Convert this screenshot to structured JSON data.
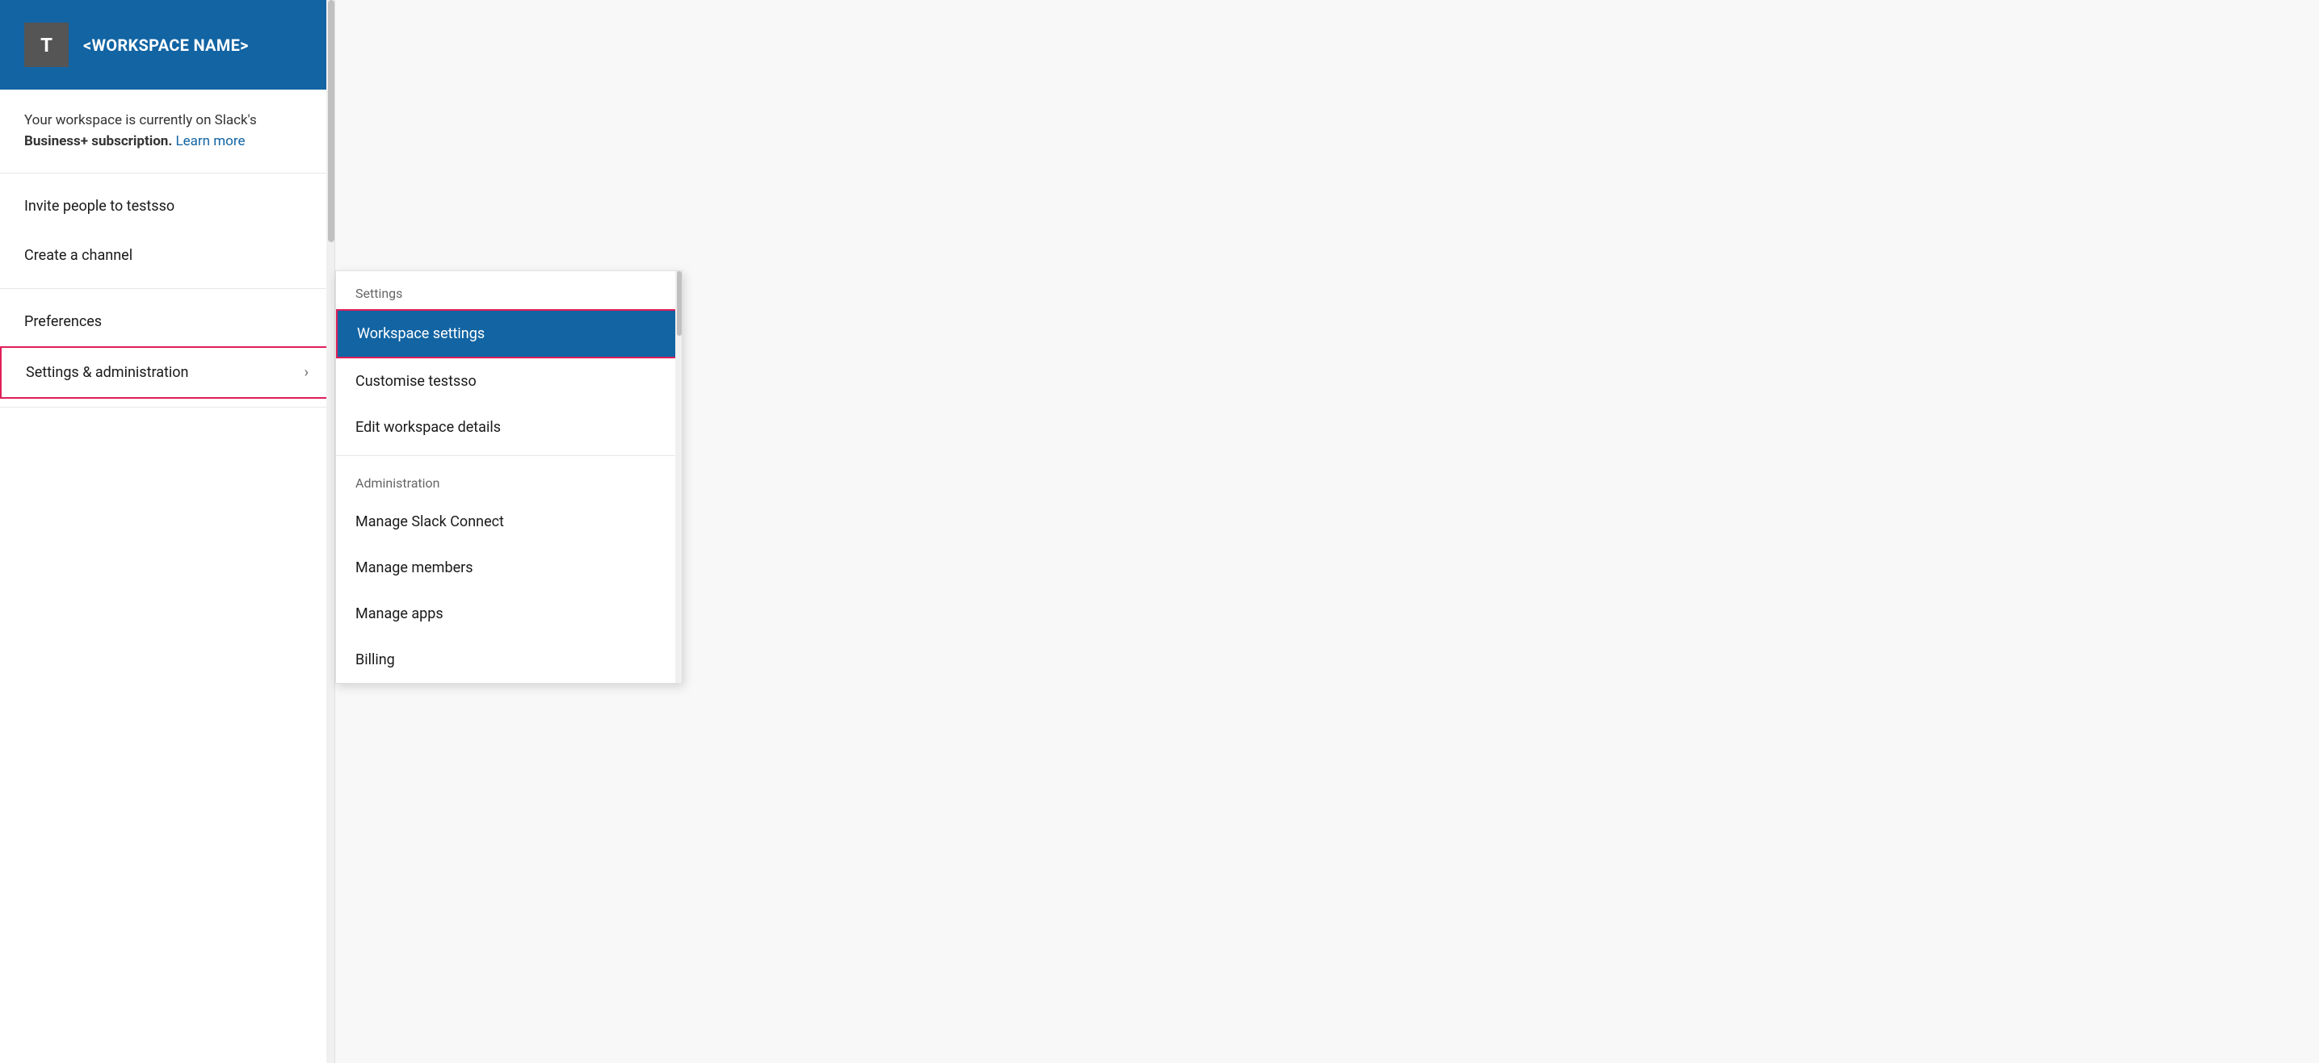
{
  "workspace": {
    "avatar_letter": "T",
    "name": "<WORKSPACE NAME>"
  },
  "subscription": {
    "text_before": "Your workspace is currently on Slack's",
    "text_bold": "Business+ subscription.",
    "learn_more": "Learn more"
  },
  "menu": {
    "invite_label": "Invite people to testsso",
    "create_channel_label": "Create a channel",
    "preferences_label": "Preferences",
    "settings_admin_label": "Settings & administration",
    "chevron": "›"
  },
  "submenu": {
    "settings_section_label": "Settings",
    "workspace_settings_label": "Workspace settings",
    "customise_label": "Customise testsso",
    "edit_workspace_label": "Edit workspace details",
    "administration_section_label": "Administration",
    "manage_slack_connect_label": "Manage Slack Connect",
    "manage_members_label": "Manage members",
    "manage_apps_label": "Manage apps",
    "billing_label": "Billing"
  }
}
